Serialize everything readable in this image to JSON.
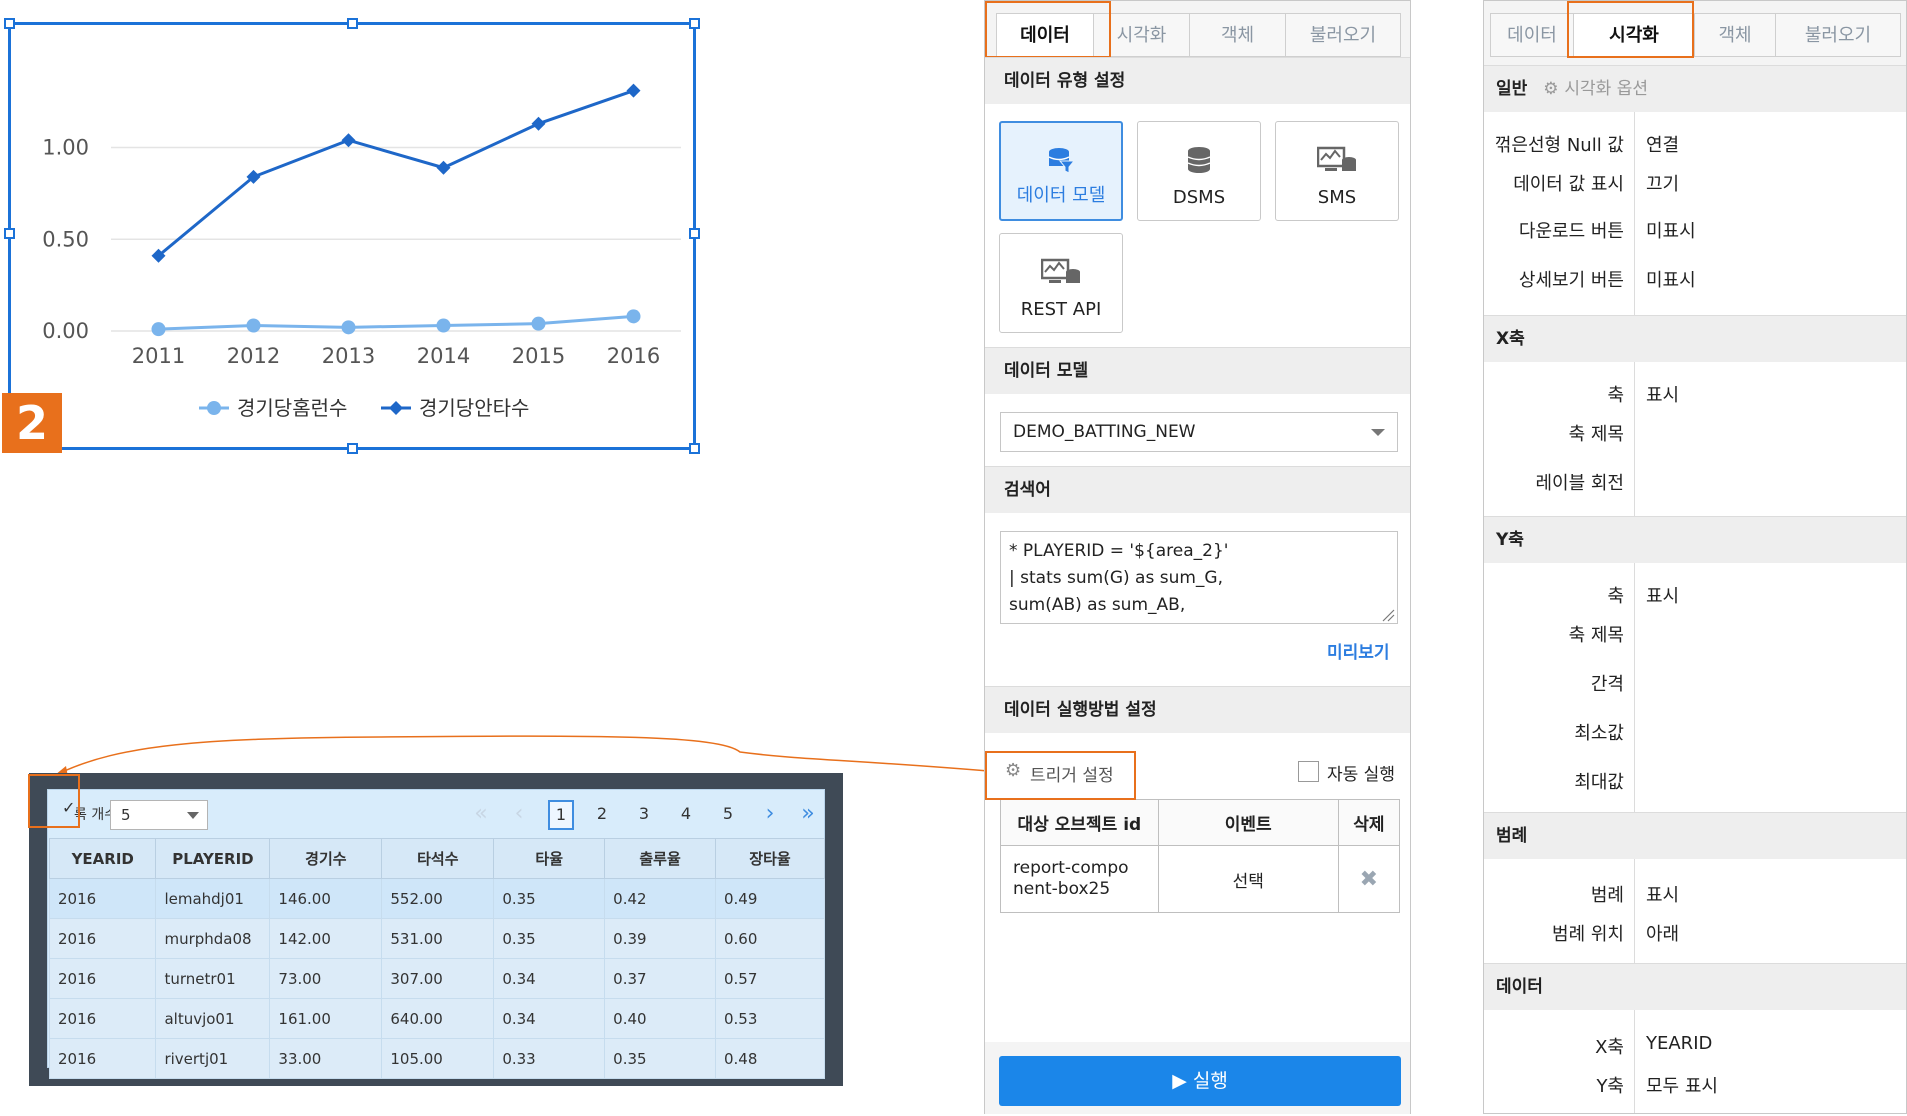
{
  "chart_widget": {
    "badge": "2",
    "chart_data": {
      "type": "line",
      "categories": [
        "2011",
        "2012",
        "2013",
        "2014",
        "2015",
        "2016"
      ],
      "series": [
        {
          "name": "경기당홈런수",
          "values": [
            0.01,
            0.03,
            0.02,
            0.03,
            0.04,
            0.08
          ],
          "color": "#7ab4ec",
          "marker": "circle"
        },
        {
          "name": "경기당안타수",
          "values": [
            0.41,
            0.84,
            1.04,
            0.89,
            1.13,
            1.31
          ],
          "color": "#1e67c8",
          "marker": "diamond"
        }
      ],
      "yticks": [
        "0.00",
        "0.50",
        "1.00"
      ],
      "ylim": [
        0,
        1.45
      ],
      "grid": true,
      "legend_position": "bottom"
    }
  },
  "table_widget": {
    "rows_label": "록 개수",
    "page_size": "5",
    "pages": [
      "1",
      "2",
      "3",
      "4",
      "5"
    ],
    "current_page": "1",
    "columns": [
      "YEARID",
      "PLAYERID",
      "경기수",
      "타석수",
      "타율",
      "출루율",
      "장타율"
    ],
    "rows": [
      [
        "2016",
        "lemahdj01",
        "146.00",
        "552.00",
        "0.35",
        "0.42",
        "0.49"
      ],
      [
        "2016",
        "murphda08",
        "142.00",
        "531.00",
        "0.35",
        "0.39",
        "0.60"
      ],
      [
        "2016",
        "turnetr01",
        "73.00",
        "307.00",
        "0.34",
        "0.37",
        "0.57"
      ],
      [
        "2016",
        "altuvjo01",
        "161.00",
        "640.00",
        "0.34",
        "0.40",
        "0.53"
      ],
      [
        "2016",
        "rivertj01",
        "33.00",
        "105.00",
        "0.33",
        "0.35",
        "0.48"
      ]
    ]
  },
  "data_panel": {
    "tabs": [
      "데이터",
      "시각화",
      "객체",
      "불러오기"
    ],
    "active_tab": "데이터",
    "type_section_title": "데이터 유형 설정",
    "types": [
      "데이터 모델",
      "DSMS",
      "SMS",
      "REST API"
    ],
    "model_section_title": "데이터 모델",
    "model_value": "DEMO_BATTING_NEW",
    "query_section_title": "검색어",
    "query_text": "* PLAYERID = '${area_2}'\n| stats sum(G) as sum_G,\nsum(AB) as sum_AB,",
    "preview_label": "미리보기",
    "exec_section_title": "데이터 실행방법 설정",
    "trigger_label": "트리거 설정",
    "auto_run_label": "자동 실행",
    "trigger_columns": [
      "대상 오브젝트 id",
      "이벤트",
      "삭제"
    ],
    "trigger_rows": [
      {
        "target": "report-compo\nnent-box25",
        "event": "선택"
      }
    ],
    "run_label": "▶ 실행"
  },
  "viz_panel": {
    "tabs": [
      "데이터",
      "시각화",
      "객체",
      "불러오기"
    ],
    "active_tab": "시각화",
    "general_title": "일반",
    "options_label": "시각화 옵션",
    "general_props": [
      {
        "label": "꺾은선형 Null 값",
        "value": "연결"
      },
      {
        "label": "데이터 값 표시",
        "value": "끄기"
      },
      {
        "label": "다운로드 버튼",
        "value": "미표시"
      },
      {
        "label": "상세보기 버튼",
        "value": "미표시"
      }
    ],
    "x_title": "X축",
    "x_props": [
      {
        "label": "축",
        "value": "표시"
      },
      {
        "label": "축 제목",
        "value": ""
      },
      {
        "label": "레이블 회전",
        "value": ""
      }
    ],
    "y_title": "Y축",
    "y_props": [
      {
        "label": "축",
        "value": "표시"
      },
      {
        "label": "축 제목",
        "value": ""
      },
      {
        "label": "간격",
        "value": ""
      },
      {
        "label": "최소값",
        "value": ""
      },
      {
        "label": "최대값",
        "value": ""
      }
    ],
    "legend_title": "범례",
    "legend_props": [
      {
        "label": "범례",
        "value": "표시"
      },
      {
        "label": "범례 위치",
        "value": "아래"
      }
    ],
    "data_title": "데이터",
    "data_props": [
      {
        "label": "X축",
        "value": "YEARID"
      },
      {
        "label": "Y축",
        "value": "모두 표시"
      }
    ]
  }
}
